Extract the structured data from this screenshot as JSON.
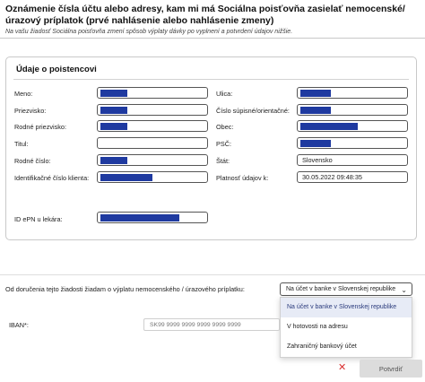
{
  "header": {
    "title": "Oznámenie čísla účtu alebo adresy, kam mi má Sociálna poisťovňa zasielať nemocenské/úrazový príplatok (prvé nahlásenie alebo nahlásenie zmeny)",
    "subtitle": "Na vašu žiadosť Sociálna poisťovňa zmení spôsob výplaty dávky po vyplnení a potvrdení údajov nižšie."
  },
  "insured": {
    "section_title": "Údaje o poistencovi",
    "left_fields": [
      {
        "label": "Meno:",
        "value": ""
      },
      {
        "label": "Priezvisko:",
        "value": ""
      },
      {
        "label": "Rodné priezvisko:",
        "value": ""
      },
      {
        "label": "Titul:",
        "value": ""
      },
      {
        "label": "Rodné číslo:",
        "value": ""
      },
      {
        "label": "Identifikačné číslo klienta:",
        "value": ""
      }
    ],
    "right_fields": [
      {
        "label": "Ulica:",
        "value": ""
      },
      {
        "label": "Číslo súpisné/orientačné:",
        "value": ""
      },
      {
        "label": "Obec:",
        "value": ""
      },
      {
        "label": "PSČ:",
        "value": ""
      },
      {
        "label": "Štát:",
        "value": "Slovensko"
      },
      {
        "label": "Platnosť údajov k:",
        "value": "30.05.2022 09:48:35"
      }
    ],
    "epn": {
      "label": "ID ePN u lekára:",
      "value": ""
    }
  },
  "payment": {
    "delivery_label": "Od doručenia tejto žiadosti žiadam o výplatu nemocenského / úrazového príplatku:",
    "selected": "Na účet v banke v Slovenskej republike",
    "options": [
      "Na účet v banke v Slovenskej republike",
      "V hotovosti na adresu",
      "Zahraničný bankový účet"
    ],
    "iban_label": "IBAN*:",
    "iban_placeholder": "SK99 9999 9999 9999 9999 9999"
  },
  "actions": {
    "close_icon": "✕",
    "confirm_label": "Potvrdiť"
  },
  "colors": {
    "redaction": "#1f3aa0",
    "close": "#d93030",
    "selected_option_bg": "#e7ebf6"
  }
}
